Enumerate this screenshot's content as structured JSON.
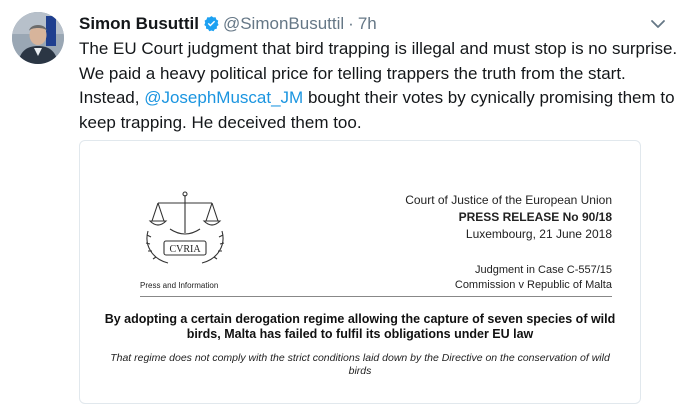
{
  "tweet": {
    "author_name": "Simon Busuttil",
    "handle": "@SimonBusuttil",
    "separator": "·",
    "time": "7h",
    "text_part1": "The EU Court judgment that bird trapping is illegal and must stop is no surprise. We paid a heavy political price for telling trappers the truth from the start. Instead, ",
    "mention": "@JosephMuscat_JM",
    "text_part2": " bought their votes by cynically promising them to keep trapping. He deceived them too."
  },
  "card": {
    "logo_text": "CVRIA",
    "press_info": "Press and Information",
    "court_name": "Court of Justice of the European Union",
    "press_release": "PRESS RELEASE No 90/18",
    "place_date": "Luxembourg, 21 June 2018",
    "judgment_case": "Judgment in Case C-557/15",
    "parties": "Commission v Republic of Malta",
    "headline": "By adopting a certain derogation regime allowing the capture of seven species of wild birds, Malta has failed to fulfil its obligations under EU law",
    "subheadline": "That regime does not comply with the strict conditions laid down by the Directive on the conservation of wild birds"
  },
  "colors": {
    "text": "#14171a",
    "muted": "#657786",
    "link": "#1b95e0",
    "verified": "#1da1f2",
    "card_border": "#e1e8ed"
  },
  "icons": {
    "verified": "verified-badge-icon",
    "caret": "chevron-down-icon"
  }
}
